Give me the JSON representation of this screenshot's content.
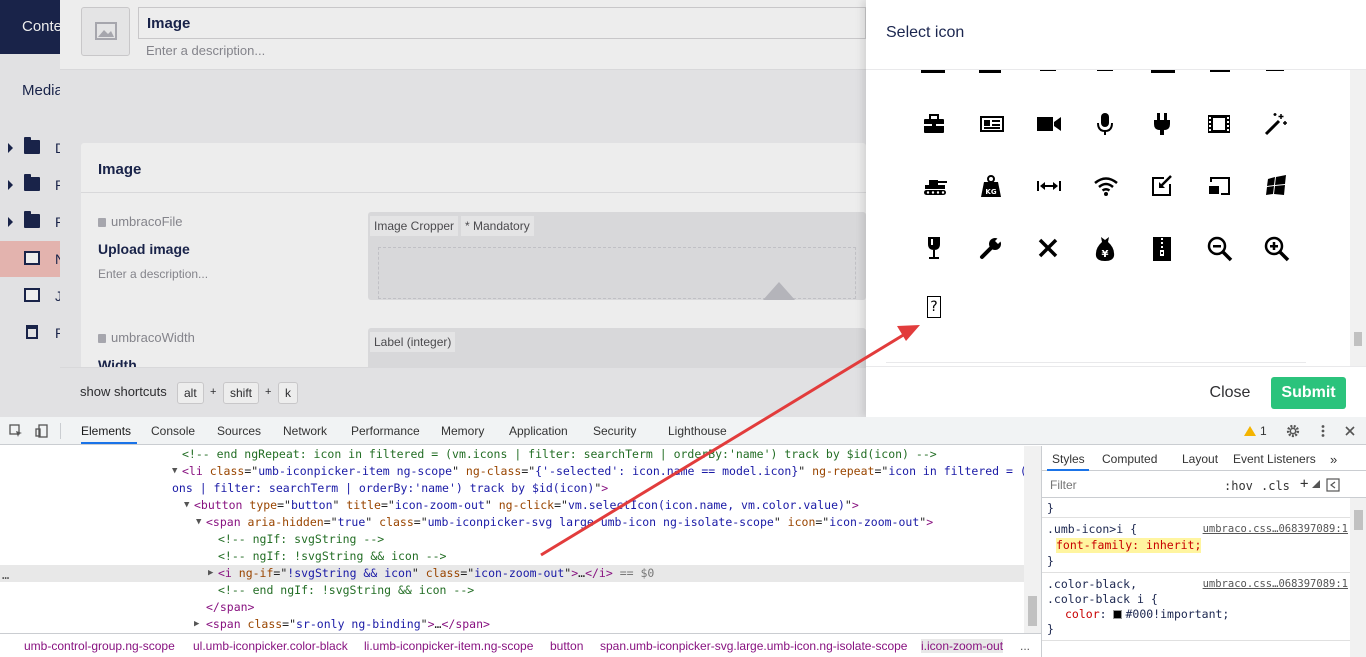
{
  "app": {
    "topnav_label": "Conte",
    "section_title": "Media",
    "tree_items": [
      {
        "label": "D",
        "icon": "folder-icon"
      },
      {
        "label": "P",
        "icon": "folder-icon"
      },
      {
        "label": "P",
        "icon": "folder-icon"
      },
      {
        "label": "N",
        "icon": "image-icon"
      },
      {
        "label": "J",
        "icon": "image-icon"
      },
      {
        "label": "R",
        "icon": "trash-icon"
      }
    ]
  },
  "editor": {
    "name_value": "Image",
    "description_placeholder": "Enter a description...",
    "group_title": "Image",
    "properties": [
      {
        "alias": "umbracoFile",
        "label": "Upload image",
        "description": "Enter a description...",
        "tags": [
          "Image Cropper",
          "* Mandatory"
        ]
      },
      {
        "alias": "umbracoWidth",
        "label": "Width",
        "tags": [
          "Label (integer)"
        ]
      }
    ],
    "shortcuts_label": "show shortcuts",
    "shortcut_keys": [
      "alt",
      "shift",
      "k"
    ],
    "shortcut_plus": "+"
  },
  "dialog": {
    "title": "Select icon",
    "icons": [
      "icon-toolbox",
      "icon-id-card",
      "icon-video",
      "icon-microphone",
      "icon-plug",
      "icon-film",
      "icon-wand",
      "icon-tank",
      "icon-weight-kg",
      "icon-width",
      "icon-wifi",
      "icon-download-arrow",
      "icon-cast",
      "icon-windows",
      "icon-wine-glass",
      "icon-wrench",
      "icon-wrong",
      "icon-yen-bag",
      "icon-zip",
      "icon-zoom-out",
      "icon-zoom-in",
      "icon-zoom-out-missing"
    ],
    "missing_glyph": "?",
    "close_label": "Close",
    "submit_label": "Submit"
  },
  "devtools": {
    "tabs": [
      "Elements",
      "Console",
      "Sources",
      "Network",
      "Performance",
      "Memory",
      "Application",
      "Security",
      "Lighthouse"
    ],
    "warning_count": "1",
    "dom_lines": [
      {
        "parts": [
          [
            "c-cmt",
            "<!-- end ngRepeat: icon in filtered = (vm.icons | filter: searchTerm | orderBy:'name') track by $id(icon) -->"
          ]
        ]
      },
      {
        "parts": [
          [
            "c-tag",
            "<li "
          ],
          [
            "c-attr",
            "class"
          ],
          [
            "c-txt",
            "=\""
          ],
          [
            "c-val",
            "umb-iconpicker-item ng-scope"
          ],
          [
            "c-txt",
            "\" "
          ],
          [
            "c-attr",
            "ng-class"
          ],
          [
            "c-txt",
            "=\""
          ],
          [
            "c-val",
            "{'-selected': icon.name == model.icon}"
          ],
          [
            "c-txt",
            "\" "
          ],
          [
            "c-attr",
            "ng-repeat"
          ],
          [
            "c-txt",
            "=\""
          ],
          [
            "c-val",
            "icon in filtered = (vm.ic"
          ]
        ]
      },
      {
        "parts": [
          [
            "c-val",
            "ons | filter: searchTerm | orderBy:'name') track by $id(icon)"
          ],
          [
            "c-txt",
            "\""
          ],
          [
            "c-tag",
            ">"
          ]
        ]
      },
      {
        "parts": [
          [
            "c-tag",
            "<button "
          ],
          [
            "c-attr",
            "type"
          ],
          [
            "c-txt",
            "=\""
          ],
          [
            "c-val",
            "button"
          ],
          [
            "c-txt",
            "\" "
          ],
          [
            "c-attr",
            "title"
          ],
          [
            "c-txt",
            "=\""
          ],
          [
            "c-val",
            "icon-zoom-out"
          ],
          [
            "c-txt",
            "\" "
          ],
          [
            "c-attr",
            "ng-click"
          ],
          [
            "c-txt",
            "=\""
          ],
          [
            "c-val",
            "vm.selectIcon(icon.name, vm.color.value)"
          ],
          [
            "c-txt",
            "\""
          ],
          [
            "c-tag",
            ">"
          ]
        ]
      },
      {
        "parts": [
          [
            "c-tag",
            "<span "
          ],
          [
            "c-attr",
            "aria-hidden"
          ],
          [
            "c-txt",
            "=\""
          ],
          [
            "c-val",
            "true"
          ],
          [
            "c-txt",
            "\" "
          ],
          [
            "c-attr",
            "class"
          ],
          [
            "c-txt",
            "=\""
          ],
          [
            "c-val",
            "umb-iconpicker-svg large umb-icon ng-isolate-scope"
          ],
          [
            "c-txt",
            "\" "
          ],
          [
            "c-attr",
            "icon"
          ],
          [
            "c-txt",
            "=\""
          ],
          [
            "c-val",
            "icon-zoom-out"
          ],
          [
            "c-txt",
            "\""
          ],
          [
            "c-tag",
            ">"
          ]
        ]
      },
      {
        "parts": [
          [
            "c-cmt",
            "<!-- ngIf: svgString -->"
          ]
        ]
      },
      {
        "parts": [
          [
            "c-cmt",
            "<!-- ngIf: !svgString && icon -->"
          ]
        ]
      },
      {
        "parts": [
          [
            "c-tag",
            "<i "
          ],
          [
            "c-attr",
            "ng-if"
          ],
          [
            "c-txt",
            "=\""
          ],
          [
            "c-val",
            "!svgString && icon"
          ],
          [
            "c-txt",
            "\" "
          ],
          [
            "c-attr",
            "class"
          ],
          [
            "c-txt",
            "=\""
          ],
          [
            "c-val",
            "icon-zoom-out"
          ],
          [
            "c-txt",
            "\""
          ],
          [
            "c-tag",
            ">"
          ],
          [
            "c-txt",
            "…"
          ],
          [
            "c-tag",
            "</i>"
          ],
          [
            "c-grey",
            " == $0"
          ]
        ]
      },
      {
        "parts": [
          [
            "c-cmt",
            "<!-- end ngIf: !svgString && icon -->"
          ]
        ]
      },
      {
        "parts": [
          [
            "c-tag",
            "</span>"
          ]
        ]
      },
      {
        "parts": [
          [
            "c-tag",
            "<span "
          ],
          [
            "c-attr",
            "class"
          ],
          [
            "c-txt",
            "=\""
          ],
          [
            "c-val",
            "sr-only ng-binding"
          ],
          [
            "c-txt",
            "\""
          ],
          [
            "c-tag",
            ">"
          ],
          [
            "c-txt",
            "…"
          ],
          [
            "c-tag",
            "</span>"
          ]
        ]
      }
    ],
    "dots": "…",
    "breadcrumbs": [
      "umb-control-group.ng-scope",
      "ul.umb-iconpicker.color-black",
      "li.umb-iconpicker-item.ng-scope",
      "button",
      "span.umb-iconpicker-svg.large.umb-icon.ng-isolate-scope",
      "i.icon-zoom-out",
      "..."
    ],
    "styles_tabs": [
      "Styles",
      "Computed",
      "Layout",
      "Event Listeners"
    ],
    "filter_placeholder": "Filter",
    "hov": ":hov",
    "cls": ".cls",
    "rules": {
      "r1_selector": ".umb-icon>i {",
      "r1_source": "umbraco.css…068397089:1",
      "r1_prop": "font-family: inherit;",
      "r1_close": "}",
      "r2_sel1": ".color-black,",
      "r2_sel2": ".color-black i {",
      "r2_source": "umbraco.css…068397089:1",
      "r2_prop_name": "color",
      "r2_prop_value": "#000!important;",
      "r2_close": "}",
      "prev_close": "}"
    }
  }
}
